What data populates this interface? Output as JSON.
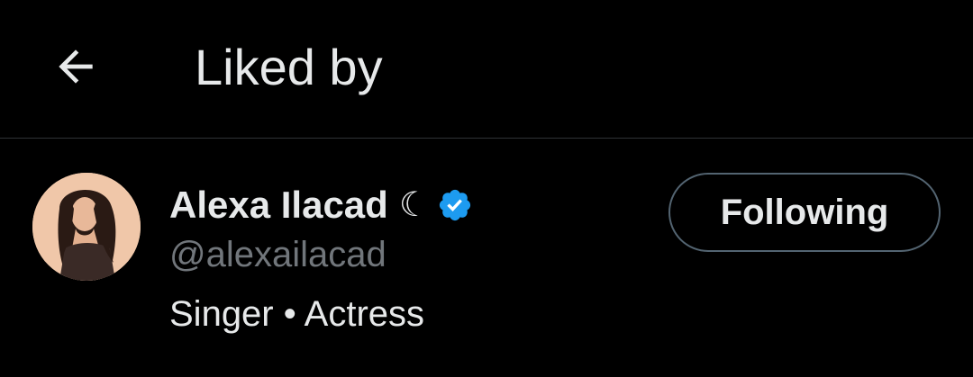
{
  "header": {
    "title": "Liked by",
    "back_icon": "arrow-left-icon"
  },
  "user": {
    "display_name": "Alexa Ilacad",
    "name_emoji": "☾",
    "verified_icon": "verified-badge-icon",
    "verified_color": "#1d9bf0",
    "handle": "@alexailacad",
    "bio": "Singer • Actress",
    "follow_button_label": "Following"
  },
  "colors": {
    "background": "#000000",
    "primary_text": "#e7e9ea",
    "secondary_text": "#71767b",
    "divider": "#2f3336",
    "button_border": "#536471"
  }
}
